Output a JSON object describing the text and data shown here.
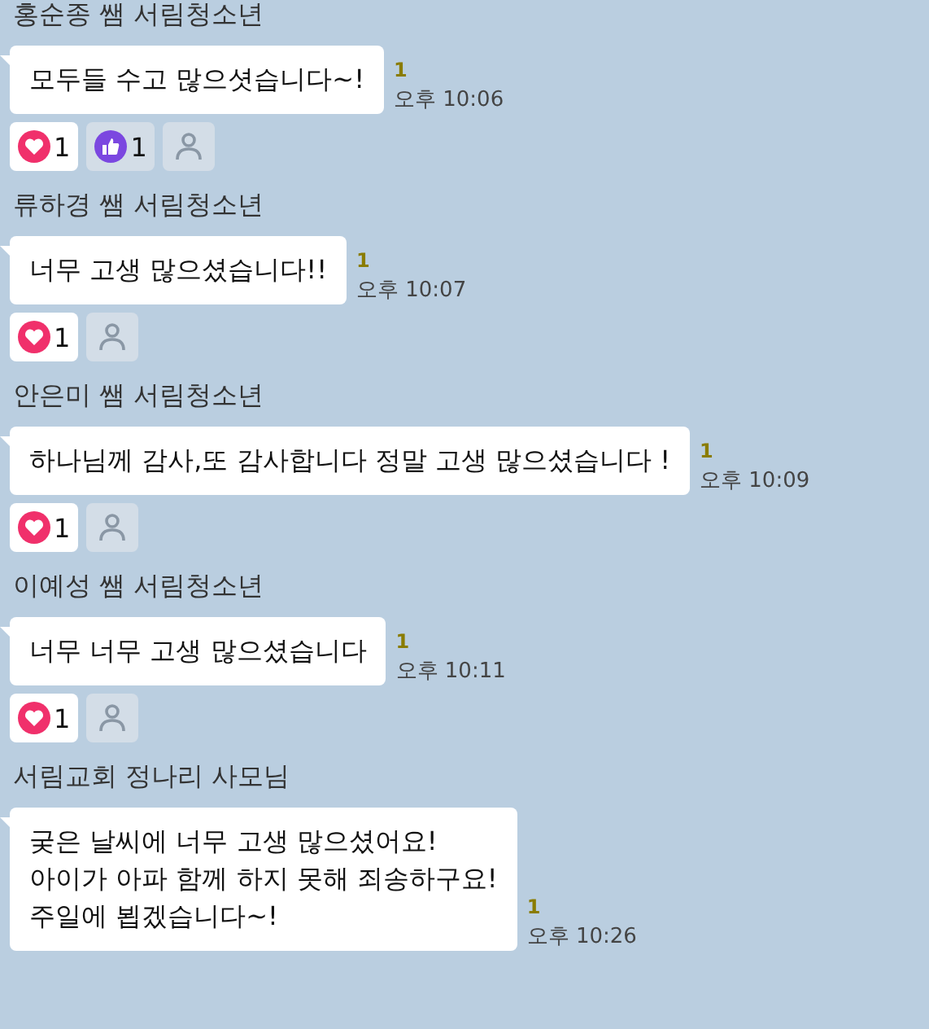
{
  "messages": [
    {
      "sender": "홍순종 쌤 서림청소년",
      "lines": [
        "모두들 수고 많으셧습니다~!"
      ],
      "unread": "1",
      "time": "오후 10:06",
      "reactions": [
        {
          "kind": "heart",
          "count": "1",
          "selected": true
        },
        {
          "kind": "like",
          "count": "1",
          "selected": false
        }
      ]
    },
    {
      "sender": "류하경 쌤 서림청소년",
      "lines": [
        "너무 고생 많으셨습니다!!"
      ],
      "unread": "1",
      "time": "오후 10:07",
      "reactions": [
        {
          "kind": "heart",
          "count": "1",
          "selected": true
        }
      ]
    },
    {
      "sender": "안은미 쌤 서림청소년",
      "lines": [
        "하나님께 감사,또 감사합니다 정말 고생 많으셨습니다 !"
      ],
      "unread": "1",
      "time": "오후 10:09",
      "reactions": [
        {
          "kind": "heart",
          "count": "1",
          "selected": true
        }
      ]
    },
    {
      "sender": "이예성 쌤 서림청소년",
      "lines": [
        "너무 너무 고생 많으셨습니다"
      ],
      "unread": "1",
      "time": "오후 10:11",
      "reactions": [
        {
          "kind": "heart",
          "count": "1",
          "selected": true
        }
      ]
    },
    {
      "sender": "서림교회 정나리 사모님",
      "lines": [
        "궂은 날씨에 너무 고생 많으셨어요!",
        "아이가 아파 함께 하지 못해 죄송하구요!",
        "주일에 뵙겠습니다~!"
      ],
      "unread": "1",
      "time": "오후 10:26"
    }
  ]
}
